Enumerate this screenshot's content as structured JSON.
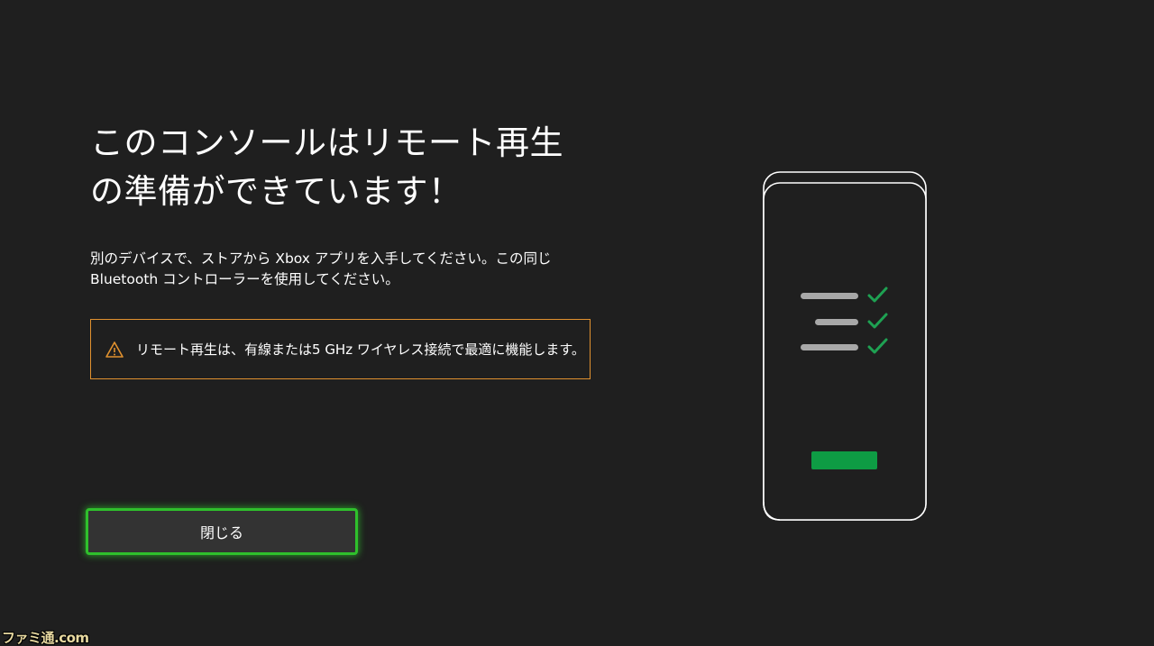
{
  "dialog": {
    "title": "このコンソールはリモート再生の準備ができています！",
    "description": "別のデバイスで、ストアから Xbox アプリを入手してください。この同じ Bluetooth コントローラーを使用してください。",
    "notice": {
      "icon": "warning-icon",
      "text": "リモート再生は、有線または5 GHz ワイヤレス接続で最適に機能します。",
      "border_color": "#e0912f"
    },
    "close_button": {
      "label": "閉じる",
      "focus_color": "#2fc02c"
    }
  },
  "illustration": {
    "icon": "phone-checklist-icon",
    "check_color": "#1ea152",
    "button_color": "#0e9c44"
  },
  "watermark": {
    "text": "ファミ通.com"
  }
}
